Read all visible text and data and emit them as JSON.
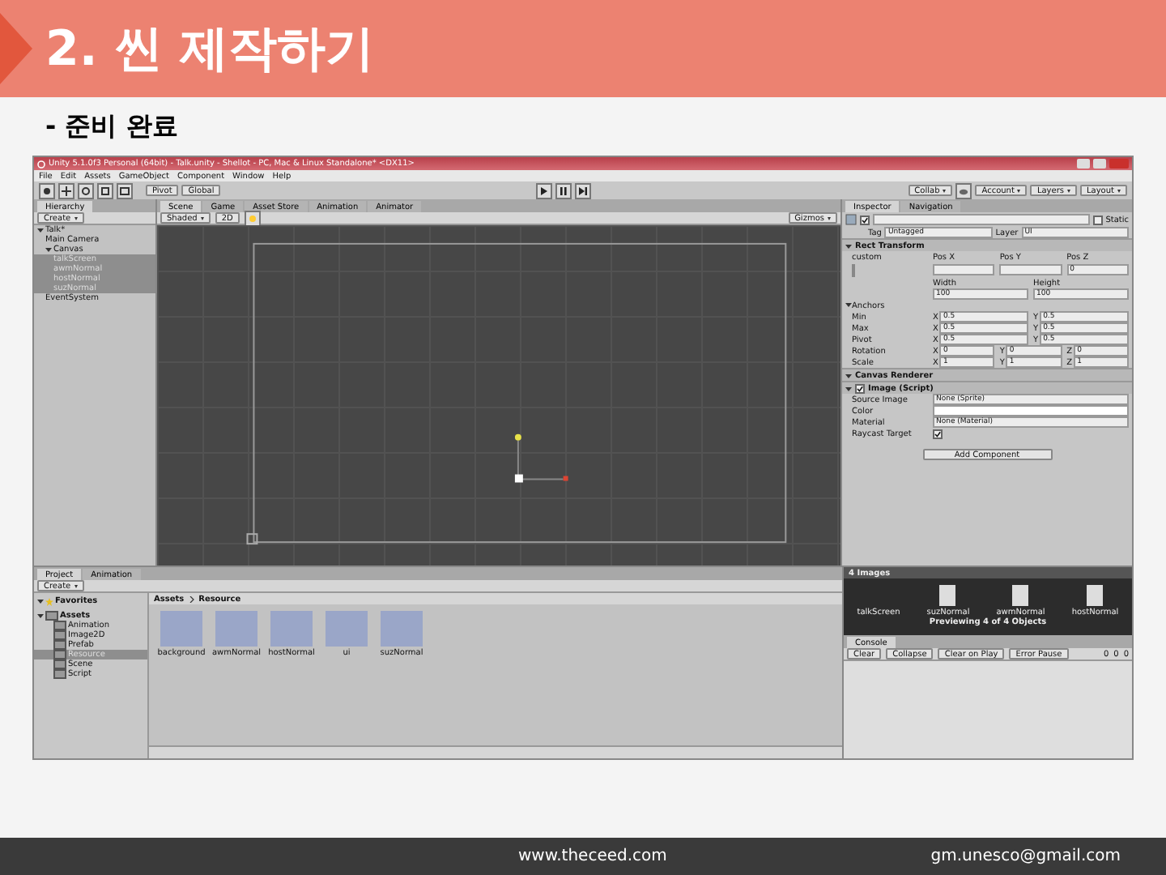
{
  "slide": {
    "title": "2. 씬 제작하기",
    "subtitle": "- 준비 완료",
    "footer_site": "www.theceed.com",
    "footer_mail": "gm.unesco@gmail.com"
  },
  "window": {
    "title": "Unity 5.1.0f3 Personal (64bit) - Talk.unity - Shellot - PC, Mac & Linux Standalone* <DX11>"
  },
  "menu": [
    "File",
    "Edit",
    "Assets",
    "GameObject",
    "Component",
    "Window",
    "Help"
  ],
  "toolbar": {
    "pivot": "Pivot",
    "global": "Global",
    "right": [
      "Collab",
      "Account",
      "Layers",
      "Layout"
    ]
  },
  "hierarchy": {
    "tab": "Hierarchy",
    "create": "Create",
    "items": [
      {
        "label": "Talk*",
        "expanded": true,
        "selected": false,
        "children": [
          {
            "label": "Main Camera",
            "selected": false
          },
          {
            "label": "Canvas",
            "expanded": true,
            "selected": false,
            "children": [
              {
                "label": "talkScreen",
                "selected": true
              },
              {
                "label": "awmNormal",
                "selected": true
              },
              {
                "label": "hostNormal",
                "selected": true
              },
              {
                "label": "suzNormal",
                "selected": true
              }
            ]
          },
          {
            "label": "EventSystem",
            "selected": false
          }
        ]
      }
    ]
  },
  "scene": {
    "tabs": [
      {
        "label": "Scene",
        "selected": true
      },
      {
        "label": "Game",
        "selected": false
      },
      {
        "label": "Asset Store",
        "selected": false
      },
      {
        "label": "Animation",
        "selected": false
      },
      {
        "label": "Animator",
        "selected": false
      }
    ],
    "shading": "Shaded",
    "mode": "2D",
    "gizmos": "Gizmos"
  },
  "inspector": {
    "tabs": [
      {
        "label": "Inspector",
        "selected": true
      },
      {
        "label": "Navigation",
        "selected": false
      }
    ],
    "active": true,
    "static_on": false,
    "static": "Static",
    "tag_label": "Tag",
    "tag": "Untagged",
    "layer_label": "Layer",
    "layer": "UI",
    "rect": {
      "title": "Rect Transform",
      "rows": [
        {
          "kind": "labels",
          "label": "custom",
          "cells": [
            "Pos X",
            "Pos Y",
            "Pos Z"
          ]
        },
        {
          "kind": "fields",
          "cells": [
            {},
            {},
            {
              "value": "0"
            }
          ]
        },
        {
          "kind": "labels",
          "cells": [
            "Width",
            "Height"
          ]
        },
        {
          "kind": "fields",
          "cells": [
            {
              "value": "100"
            },
            {
              "value": "100"
            }
          ]
        },
        {
          "kind": "group",
          "label": "Anchors"
        },
        {
          "kind": "fields",
          "label": "Min",
          "cells": [
            {
              "prefix": "X",
              "value": "0.5"
            },
            {
              "prefix": "Y",
              "value": "0.5"
            }
          ]
        },
        {
          "kind": "fields",
          "label": "Max",
          "cells": [
            {
              "prefix": "X",
              "value": "0.5"
            },
            {
              "prefix": "Y",
              "value": "0.5"
            }
          ]
        },
        {
          "kind": "fields",
          "label": "Pivot",
          "cells": [
            {
              "prefix": "X",
              "value": "0.5"
            },
            {
              "prefix": "Y",
              "value": "0.5"
            }
          ]
        },
        {
          "kind": "fields",
          "label": "Rotation",
          "cells": [
            {
              "prefix": "X",
              "value": "0"
            },
            {
              "prefix": "Y",
              "value": "0"
            },
            {
              "prefix": "Z",
              "value": "0"
            }
          ]
        },
        {
          "kind": "fields",
          "label": "Scale",
          "cells": [
            {
              "prefix": "X",
              "value": "1"
            },
            {
              "prefix": "Y",
              "value": "1"
            },
            {
              "prefix": "Z",
              "value": "1"
            }
          ]
        }
      ]
    },
    "canvas_renderer": "Canvas Renderer",
    "image": {
      "title": "Image (Script)",
      "enabled": true,
      "props": [
        {
          "kind": "field",
          "label": "Source Image",
          "value": "None (Sprite)"
        },
        {
          "kind": "color",
          "label": "Color",
          "color": "#ffffff"
        },
        {
          "kind": "field",
          "label": "Material",
          "value": "None (Material)"
        },
        {
          "kind": "check",
          "label": "Raycast Target",
          "checked": true
        }
      ]
    },
    "add_component": "Add Component"
  },
  "preview": {
    "title": "4 Images",
    "items": [
      "talkScreen",
      "suzNormal",
      "awmNormal",
      "hostNormal"
    ],
    "caption": "Previewing 4 of 4 Objects"
  },
  "console": {
    "tab": "Console",
    "buttons": [
      "Clear",
      "Collapse",
      "Clear on Play",
      "Error Pause"
    ],
    "counts": [
      "0",
      "0",
      "0"
    ]
  },
  "project": {
    "tabs": [
      {
        "label": "Project",
        "selected": true
      },
      {
        "label": "Animation",
        "selected": false
      }
    ],
    "create": "Create",
    "favorites": "Favorites",
    "assets": "Assets",
    "folders": [
      {
        "label": "Animation",
        "selected": false
      },
      {
        "label": "Image2D",
        "selected": false
      },
      {
        "label": "Prefab",
        "selected": false
      },
      {
        "label": "Resource",
        "selected": true
      },
      {
        "label": "Scene",
        "selected": false
      },
      {
        "label": "Script",
        "selected": false
      }
    ],
    "breadcrumb": [
      "Assets",
      "Resource"
    ],
    "files": [
      "background",
      "awmNormal",
      "hostNormal",
      "ui",
      "suzNormal"
    ]
  }
}
